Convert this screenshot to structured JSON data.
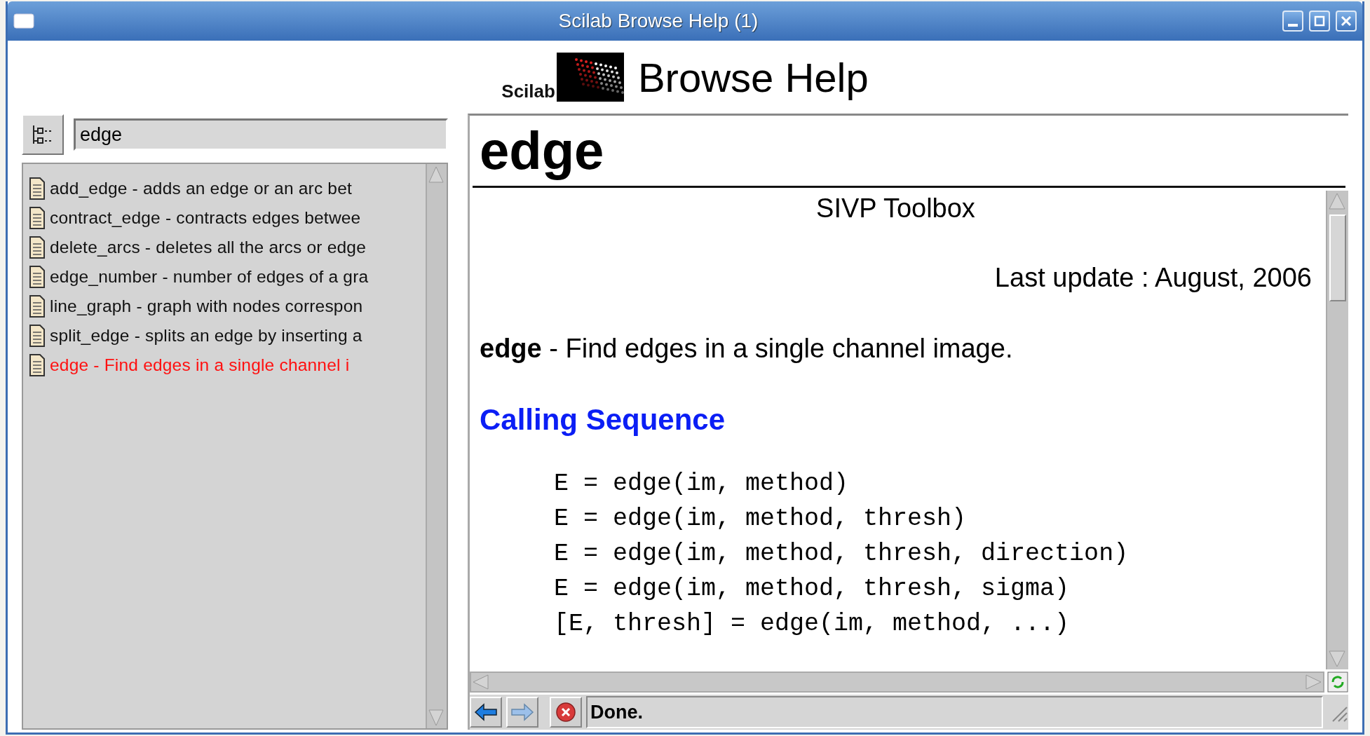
{
  "window": {
    "title": "Scilab Browse Help (1)"
  },
  "header": {
    "logo": "Scilab",
    "title": "Browse Help"
  },
  "search": {
    "value": "edge"
  },
  "results": [
    {
      "text": "add_edge - adds an edge or an arc bet",
      "selected": false
    },
    {
      "text": "contract_edge - contracts edges betwee",
      "selected": false
    },
    {
      "text": "delete_arcs - deletes all the arcs or edge",
      "selected": false
    },
    {
      "text": "edge_number - number of edges of a gra",
      "selected": false
    },
    {
      "text": "line_graph - graph with nodes correspon",
      "selected": false
    },
    {
      "text": "split_edge - splits an edge by inserting a",
      "selected": false
    },
    {
      "text": "edge - Find edges in a single channel i",
      "selected": true
    }
  ],
  "document": {
    "heading": "edge",
    "toolbox": "SIVP Toolbox",
    "last_update": "Last update : August, 2006",
    "summary": "**edge** - Find edges in a single channel image.",
    "section": "Calling Sequence",
    "code": [
      "E = edge(im, method)",
      "E = edge(im, method, thresh)",
      "E = edge(im, method, thresh, direction)",
      "E = edge(im, method, thresh, sigma)",
      "[E, thresh] = edge(im, method, ...)"
    ]
  },
  "nav_buttons": [
    {
      "kind": "back",
      "disabled": false
    },
    {
      "kind": "forward",
      "disabled": true
    },
    {
      "kind": "stop",
      "disabled": false
    }
  ],
  "status_bar": {
    "text": "Done."
  }
}
